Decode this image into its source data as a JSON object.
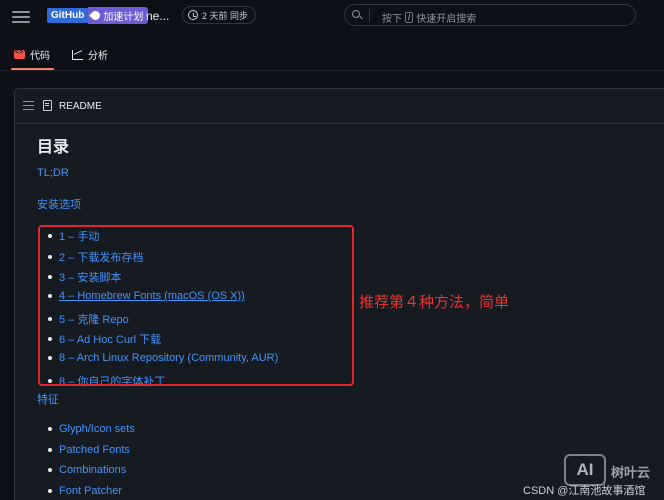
{
  "topbar": {
    "badge_github": "GitHub",
    "badge_plan": "加速计划",
    "repo_name": "ne...",
    "sync_text": "2 天前 同步",
    "search_prefix": "按下",
    "search_key": "/",
    "search_suffix": "快速开启搜索"
  },
  "tabs": [
    {
      "label": "代码",
      "icon": "code-icon",
      "active": true
    },
    {
      "label": "分析",
      "icon": "graph-icon",
      "active": false
    }
  ],
  "readme": {
    "label": "README",
    "heading": "目录",
    "tldr": "TL;DR",
    "install_options": "安装选项",
    "install_items": [
      "1 – 手动",
      "2 – 下载发布存档",
      "3 – 安装脚本",
      "4 – Homebrew Fonts (macOS (OS X))",
      "5 – 克隆 Repo",
      "6 – Ad Hoc Curl 下载",
      "8 – Arch Linux Repository (Community, AUR)",
      "8 – 你自己的字体补丁"
    ],
    "features": "特征",
    "feature_items": [
      "Glyph/Icon sets",
      "Patched Fonts",
      "Combinations",
      "Font Patcher"
    ]
  },
  "annotation": "推荐第４种方法，简单",
  "watermark": {
    "logo": "AI",
    "brand": "树叶云",
    "credit": "CSDN @江南池故事酒馆"
  },
  "colors": {
    "background": "#0d1117",
    "panel": "#161b22",
    "link": "#4493f8",
    "annotation_red": "#e3262b"
  }
}
